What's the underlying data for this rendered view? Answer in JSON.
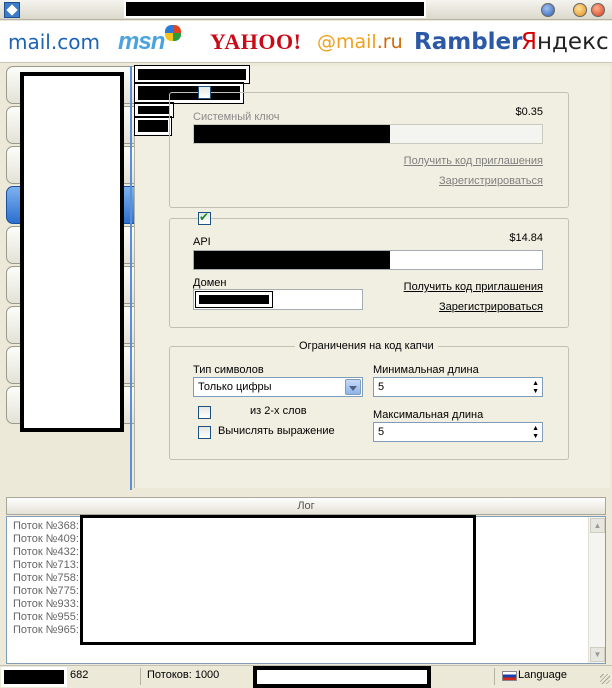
{
  "services": {
    "logos": [
      {
        "name": "mailcom",
        "text": "mail.com"
      },
      {
        "name": "msn",
        "text": "msn"
      },
      {
        "name": "yahoo",
        "text": "YAHOO!"
      },
      {
        "name": "gmailru",
        "text": "@mail",
        "suffix": ".ru"
      },
      {
        "name": "rambler",
        "text": "Rambler"
      },
      {
        "name": "yandex",
        "first": "Я",
        "rest": "ндекс"
      }
    ]
  },
  "antigate": {
    "key_label": "Системный ключ",
    "price": "$0.35",
    "invite_link": "Получить код приглашения",
    "register_link": "Зарегистрироваться",
    "enabled": false
  },
  "captcha_service": {
    "api_label": "API",
    "price": "$14.84",
    "domain_label": "Домен",
    "invite_link": "Получить код приглашения",
    "register_link": "Зарегистрироваться",
    "enabled": true
  },
  "limits": {
    "legend": "Ограничения на код капчи",
    "symbol_type_label": "Тип символов",
    "symbol_type_value": "Только цифры",
    "two_words_label": "из 2-х слов",
    "calc_label": "Вычислять выражение",
    "min_length_label": "Минимальная длина",
    "min_length_value": "5",
    "max_length_label": "Максимальная длина",
    "max_length_value": "5"
  },
  "log": {
    "title": "Лог",
    "lines": [
      "Поток №368:",
      "Поток №409:",
      "Поток №432:",
      "Поток №713:",
      "Поток №758:",
      "Поток №775:",
      "Поток №933:",
      "Поток №955:",
      "Поток №965:"
    ]
  },
  "status": {
    "count": "682",
    "threads": "Потоков: 1000",
    "language": "Language"
  },
  "colors": {
    "accent": "#2c6fcf",
    "window_bg": "#ece9d8"
  }
}
